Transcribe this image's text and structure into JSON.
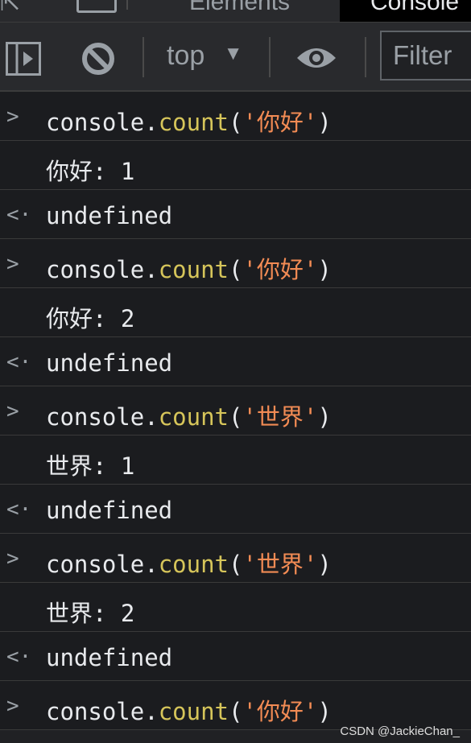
{
  "tabs": [
    {
      "label": "Elements"
    },
    {
      "label": "Console",
      "active": true
    }
  ],
  "toolbar": {
    "context": "top",
    "filter_placeholder": "Filter"
  },
  "entries": [
    {
      "type": "input",
      "obj": "console.",
      "fn": "count",
      "open": "(",
      "arg": "'你好'",
      "close": ")"
    },
    {
      "type": "log",
      "text": "你好: 1"
    },
    {
      "type": "result",
      "text": "undefined"
    },
    {
      "type": "input",
      "obj": "console.",
      "fn": "count",
      "open": "(",
      "arg": "'你好'",
      "close": ")"
    },
    {
      "type": "log",
      "text": "你好: 2"
    },
    {
      "type": "result",
      "text": "undefined"
    },
    {
      "type": "input",
      "obj": "console.",
      "fn": "count",
      "open": "(",
      "arg": "'世界'",
      "close": ")"
    },
    {
      "type": "log",
      "text": "世界: 1"
    },
    {
      "type": "result",
      "text": "undefined"
    },
    {
      "type": "input",
      "obj": "console.",
      "fn": "count",
      "open": "(",
      "arg": "'世界'",
      "close": ")"
    },
    {
      "type": "log",
      "text": "世界: 2"
    },
    {
      "type": "result",
      "text": "undefined"
    },
    {
      "type": "input",
      "obj": "console.",
      "fn": "count",
      "open": "(",
      "arg": "'你好'",
      "close": ")"
    }
  ],
  "watermark": "CSDN @JackieChan_"
}
